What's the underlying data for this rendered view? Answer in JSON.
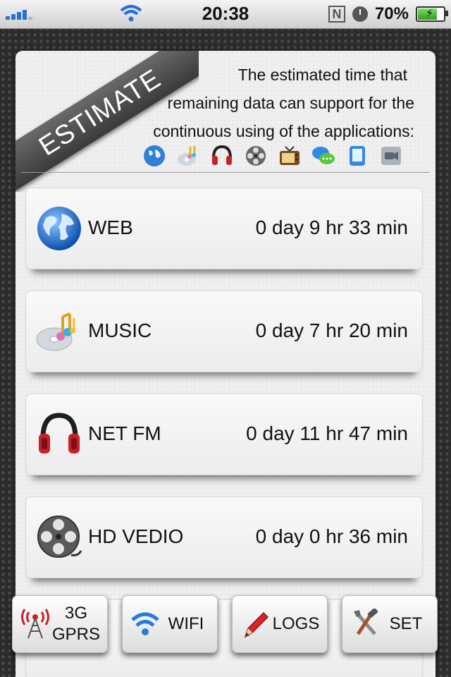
{
  "status_bar": {
    "time": "20:38",
    "battery": "70%",
    "battery_level": 0.7
  },
  "banner": {
    "ribbon_label": "ESTIMATE",
    "description_line1": "The estimated time that",
    "description_line2": "remaining data can support for the",
    "description_line3": "continuous using of the applications:"
  },
  "app_icons": [
    "globe-icon",
    "music-cd-icon",
    "headphones-icon",
    "film-reel-icon",
    "tv-icon",
    "chat-bubbles-icon",
    "tablet-icon",
    "video-camera-icon"
  ],
  "rows": [
    {
      "name": "WEB",
      "time": "0 day 9 hr 33 min",
      "icon": "globe-icon"
    },
    {
      "name": "MUSIC",
      "time": "0 day 7 hr 20 min",
      "icon": "music-cd-icon"
    },
    {
      "name": "NET FM",
      "time": "0 day 11 hr 47 min",
      "icon": "headphones-icon"
    },
    {
      "name": "HD VEDIO",
      "time": "0 day 0 hr 36 min",
      "icon": "film-reel-icon"
    }
  ],
  "tabs": [
    {
      "line1": "3G",
      "line2": "GPRS",
      "icon": "cell-tower-icon"
    },
    {
      "label": "WIFI",
      "icon": "wifi-icon"
    },
    {
      "label": "LOGS",
      "icon": "pencil-icon"
    },
    {
      "label": "SET",
      "icon": "tools-icon"
    }
  ],
  "colors": {
    "accent_blue": "#2a6fd6",
    "panel": "#efefef",
    "ribbon": "#4a4a4a",
    "background": "#2b2b2b"
  }
}
